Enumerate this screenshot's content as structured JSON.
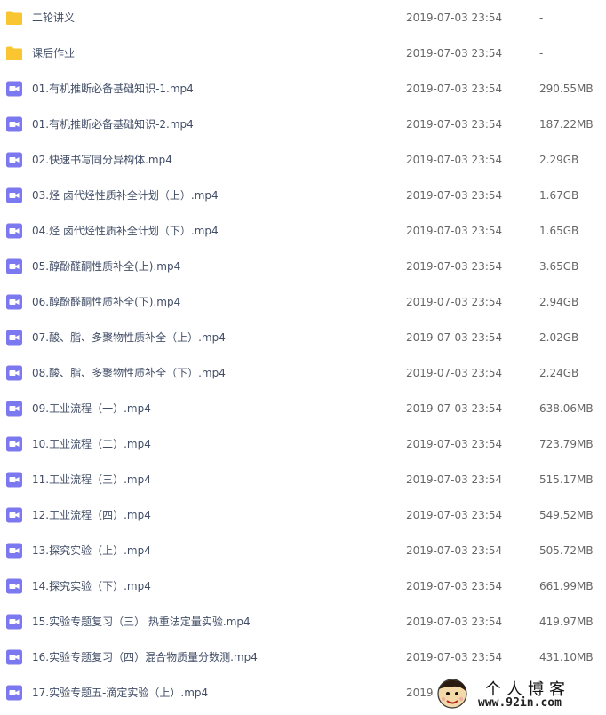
{
  "colors": {
    "folder": "#f9c631",
    "video": "#7b78f0",
    "name_text": "#424e67",
    "meta_text": "#666666"
  },
  "files": [
    {
      "icon": "folder-icon",
      "name": "二轮讲义",
      "date": "2019-07-03 23:54",
      "size": "-"
    },
    {
      "icon": "folder-icon",
      "name": "课后作业",
      "date": "2019-07-03 23:54",
      "size": "-"
    },
    {
      "icon": "video-file-icon",
      "name": "01.有机推断必备基础知识-1.mp4",
      "date": "2019-07-03 23:54",
      "size": "290.55MB"
    },
    {
      "icon": "video-file-icon",
      "name": "01.有机推断必备基础知识-2.mp4",
      "date": "2019-07-03 23:54",
      "size": "187.22MB"
    },
    {
      "icon": "video-file-icon",
      "name": "02.快速书写同分异构体.mp4",
      "date": "2019-07-03 23:54",
      "size": "2.29GB"
    },
    {
      "icon": "video-file-icon",
      "name": "03.烃 卤代烃性质补全计划（上）.mp4",
      "date": "2019-07-03 23:54",
      "size": "1.67GB"
    },
    {
      "icon": "video-file-icon",
      "name": "04.烃 卤代烃性质补全计划（下）.mp4",
      "date": "2019-07-03 23:54",
      "size": "1.65GB"
    },
    {
      "icon": "video-file-icon",
      "name": "05.醇酚醛酮性质补全(上).mp4",
      "date": "2019-07-03 23:54",
      "size": "3.65GB"
    },
    {
      "icon": "video-file-icon",
      "name": "06.醇酚醛酮性质补全(下).mp4",
      "date": "2019-07-03 23:54",
      "size": "2.94GB"
    },
    {
      "icon": "video-file-icon",
      "name": "07.酸、脂、多聚物性质补全（上）.mp4",
      "date": "2019-07-03 23:54",
      "size": "2.02GB"
    },
    {
      "icon": "video-file-icon",
      "name": "08.酸、脂、多聚物性质补全（下）.mp4",
      "date": "2019-07-03 23:54",
      "size": "2.24GB"
    },
    {
      "icon": "video-file-icon",
      "name": "09.工业流程（一）.mp4",
      "date": "2019-07-03 23:54",
      "size": "638.06MB"
    },
    {
      "icon": "video-file-icon",
      "name": "10.工业流程（二）.mp4",
      "date": "2019-07-03 23:54",
      "size": "723.79MB"
    },
    {
      "icon": "video-file-icon",
      "name": "11.工业流程（三）.mp4",
      "date": "2019-07-03 23:54",
      "size": "515.17MB"
    },
    {
      "icon": "video-file-icon",
      "name": "12.工业流程（四）.mp4",
      "date": "2019-07-03 23:54",
      "size": "549.52MB"
    },
    {
      "icon": "video-file-icon",
      "name": "13.探究实验（上）.mp4",
      "date": "2019-07-03 23:54",
      "size": "505.72MB"
    },
    {
      "icon": "video-file-icon",
      "name": "14.探究实验（下）.mp4",
      "date": "2019-07-03 23:54",
      "size": "661.99MB"
    },
    {
      "icon": "video-file-icon",
      "name": "15.实验专题复习（三） 热重法定量实验.mp4",
      "date": "2019-07-03 23:54",
      "size": "419.97MB"
    },
    {
      "icon": "video-file-icon",
      "name": "16.实验专题复习（四）混合物质量分数测.mp4",
      "date": "2019-07-03 23:54",
      "size": "431.10MB"
    },
    {
      "icon": "video-file-icon",
      "name": "17.实验专题五-滴定实验（上）.mp4",
      "date": "2019",
      "size": ""
    }
  ],
  "watermark": {
    "title": "个人博客",
    "url": "www.92in.com"
  }
}
